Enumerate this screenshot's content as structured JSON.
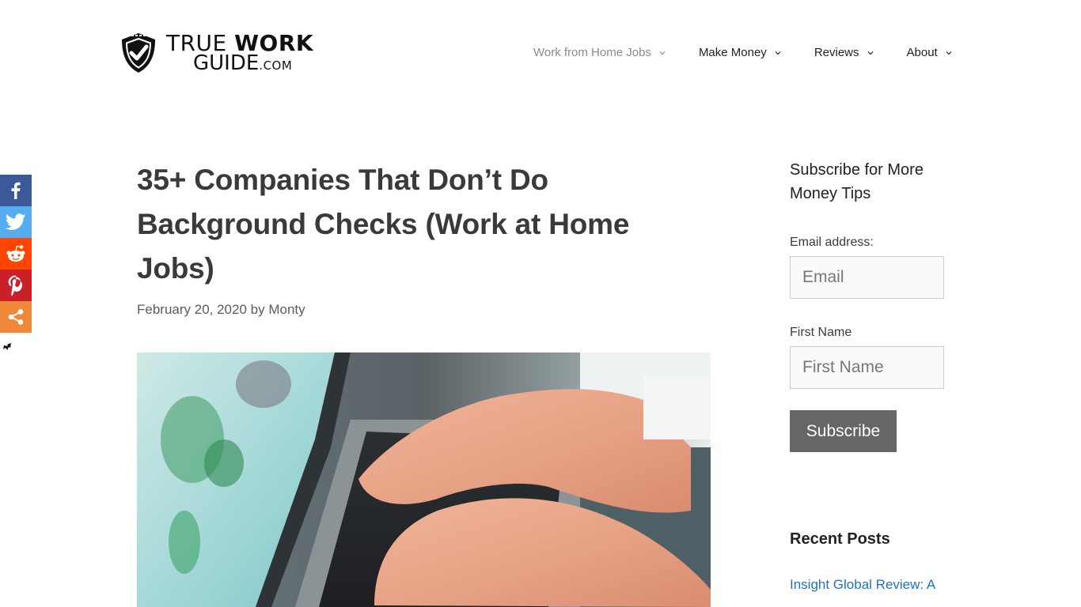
{
  "site": {
    "logo": {
      "line1_light": "TRUE ",
      "line1_bold": "WORK",
      "line2": "GUIDE",
      "line2_suffix": ".COM"
    }
  },
  "nav": {
    "items": [
      {
        "label": "Work from Home Jobs",
        "current": true
      },
      {
        "label": "Make Money",
        "current": false
      },
      {
        "label": "Reviews",
        "current": false
      },
      {
        "label": "About",
        "current": false
      }
    ]
  },
  "share": {
    "buttons": [
      {
        "name": "facebook",
        "icon": "facebook-icon",
        "color": "#3b5998"
      },
      {
        "name": "twitter",
        "icon": "twitter-icon",
        "color": "#55acee"
      },
      {
        "name": "reddit",
        "icon": "reddit-icon",
        "color": "#ff4500"
      },
      {
        "name": "pinterest",
        "icon": "pinterest-icon",
        "color": "#cb2027"
      },
      {
        "name": "more",
        "icon": "share-icon",
        "color": "#f0883a"
      }
    ]
  },
  "article": {
    "title": "35+ Companies That Don’t Do Background Checks (Work at Home Jobs)",
    "date": "February 20, 2020",
    "by": " by ",
    "author": "Monty",
    "image_alt": "Hands typing on a laptop keyboard"
  },
  "sidebar": {
    "subscribe": {
      "title": "Subscribe for More Money Tips",
      "email_label": "Email address:",
      "email_placeholder": "Email",
      "email_value": "",
      "name_label": "First Name",
      "name_placeholder": "First Name",
      "name_value": "",
      "button_label": "Subscribe"
    },
    "recent_posts": {
      "title": "Recent Posts",
      "items": [
        {
          "label": "Insight Global Review: A"
        }
      ]
    }
  },
  "colors": {
    "link": "#1e73be",
    "button": "#666666",
    "text": "#3a3a3a"
  }
}
